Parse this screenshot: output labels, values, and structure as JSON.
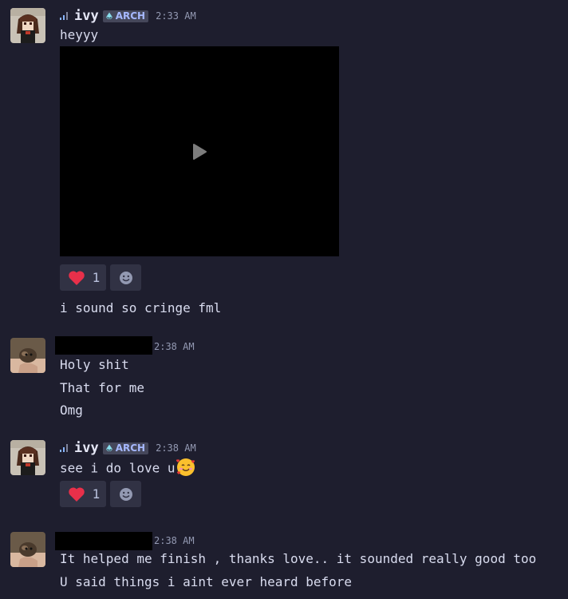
{
  "messages": [
    {
      "author": "ivy",
      "badge": "ARCH",
      "time": "2:33 AM",
      "lines": [
        "heyyy"
      ],
      "has_video": true,
      "reactions": {
        "heart_count": "1"
      },
      "followup": "i sound so cringe fml"
    },
    {
      "author_redacted": true,
      "time": "2:38 AM",
      "lines": [
        "Holy shit",
        "That for me",
        "Omg"
      ]
    },
    {
      "author": "ivy",
      "badge": "ARCH",
      "time": "2:38 AM",
      "lines": [
        "see i do love u"
      ],
      "emoji": "smiling-face-with-hearts",
      "reactions": {
        "heart_count": "1"
      }
    },
    {
      "author_redacted": true,
      "time": "2:38 AM",
      "lines": [
        "It helped me finish , thanks love.. it sounded really good too",
        "U said things i aint ever heard before"
      ]
    }
  ],
  "icons": {
    "play": "play-icon",
    "heart": "heart-icon",
    "add_reaction": "add-reaction-icon",
    "signal": "signal-icon",
    "badge_drop": "drop-icon"
  },
  "colors": {
    "background": "#1e1e2e",
    "heart": "#e8304a",
    "badge_text": "#a6b8ff",
    "signal_active": "#89b4fa"
  }
}
